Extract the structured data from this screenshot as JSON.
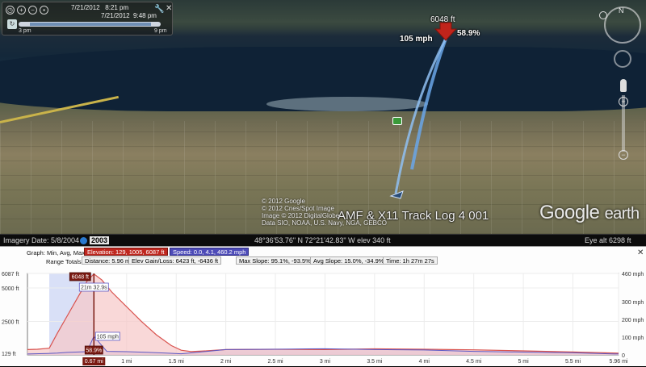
{
  "timeslider": {
    "zoom_in": "+",
    "zoom_out": "−",
    "date_start": "7/21/2012",
    "time_start": "8:21 pm",
    "date_end": "7/21/2012",
    "time_end": "9:48 pm",
    "label_left": "3 pm",
    "label_right": "9 pm"
  },
  "nav": {
    "north": "N"
  },
  "map": {
    "altitude_label": "6048 ft",
    "speed_label": "105 mph",
    "grade_label": "58.9%",
    "track_name": "AMF & X11 Track Log 4 001",
    "copyright_lines": [
      "© 2012 Google",
      "© 2012 Cnes/Spot Image",
      "Image © 2012 DigitalGlobe",
      "Data SIO, NOAA, U.S. Navy, NGA, GEBCO"
    ],
    "logo_google": "Google",
    "logo_earth": "earth"
  },
  "statusbar": {
    "imagery_date": "Imagery Date: 5/8/2004",
    "year": "2003",
    "coords": "48°36'53.76\" N  72°21'42.83\" W  elev  340 ft",
    "eye_alt": "Eye alt    6298 ft"
  },
  "profile": {
    "graph_label": "Graph:",
    "min_avg_max": "Min, Avg, Max:",
    "elevation": "Elevation: 129, 1005, 6087 ft",
    "speed": "Speed: 0.0, 4.1, 460.2 mph",
    "range_totals_label": "Range Totals:",
    "distance": "Distance: 5.96 mi",
    "elev_gain_loss": "Elev Gain/Loss: 6423 ft, -6436 ft",
    "max_slope": "Max Slope: 95.1%, -93.5%",
    "avg_slope": "Avg Slope: 15.0%, -34.9%",
    "time": "Time: 1h 27m 27s",
    "close": "✕"
  },
  "chart_data": {
    "type": "area",
    "title": "",
    "xlabel": "",
    "ylabel_left": "",
    "ylabel_right": "",
    "x_unit": "mi",
    "xlim": [
      0,
      5.96
    ],
    "y_left_ticks": [
      "129 ft",
      "2500 ft",
      "5000 ft",
      "6087 ft"
    ],
    "y_left_values": [
      129,
      2500,
      5000,
      6087
    ],
    "y_left_lim": [
      0,
      6087
    ],
    "y_right_ticks": [
      "0",
      "100 mph",
      "200 mph",
      "300 mph",
      "460 mph"
    ],
    "y_right_values": [
      0,
      100,
      200,
      300,
      460
    ],
    "y_right_lim": [
      0,
      460
    ],
    "x_ticks": [
      "0.67 mi",
      "1 mi",
      "1.5 mi",
      "2 mi",
      "2.5 mi",
      "3 mi",
      "3.5 mi",
      "4 mi",
      "4.5 mi",
      "5 mi",
      "5.5 mi",
      "5.96 mi"
    ],
    "x_tick_values": [
      0.67,
      1,
      1.5,
      2,
      2.5,
      3,
      3.5,
      4,
      4.5,
      5,
      5.5,
      5.96
    ],
    "grid": true,
    "selection_range": [
      0.22,
      0.67
    ],
    "cursor_x": 0.67,
    "series": [
      {
        "name": "Elevation",
        "axis": "left",
        "color": "#d9534f",
        "fill": "#f6c8c8",
        "x": [
          0,
          0.1,
          0.22,
          0.3,
          0.4,
          0.5,
          0.6,
          0.67,
          0.75,
          0.85,
          1.0,
          1.15,
          1.3,
          1.45,
          1.55,
          1.65,
          1.8,
          2.0,
          2.5,
          3.0,
          3.5,
          4.0,
          4.5,
          5.0,
          5.5,
          5.96
        ],
        "y": [
          400,
          420,
          500,
          1600,
          2900,
          4200,
          5500,
          6048,
          5600,
          4700,
          3600,
          2500,
          1500,
          700,
          350,
          250,
          300,
          400,
          420,
          400,
          450,
          420,
          380,
          300,
          220,
          129
        ]
      },
      {
        "name": "Speed",
        "axis": "right",
        "color": "#5b57c4",
        "fill": "#c9c4ee",
        "x": [
          0,
          0.2,
          0.3,
          0.4,
          0.6,
          0.67,
          0.8,
          1.0,
          1.2,
          1.4,
          1.55,
          1.7,
          2.0,
          2.5,
          3.0,
          3.5,
          4.0,
          4.5,
          5.0,
          5.5,
          5.96
        ],
        "y": [
          5,
          8,
          10,
          14,
          18,
          105,
          20,
          18,
          15,
          10,
          6,
          14,
          30,
          32,
          35,
          30,
          28,
          20,
          16,
          12,
          5
        ]
      }
    ],
    "markers": {
      "elevation_label": "6048 ft",
      "speed_label": "105 mph",
      "time_label": "21m 32.9s",
      "grade_label": "58.9%",
      "x_label": "0.67 mi"
    }
  }
}
